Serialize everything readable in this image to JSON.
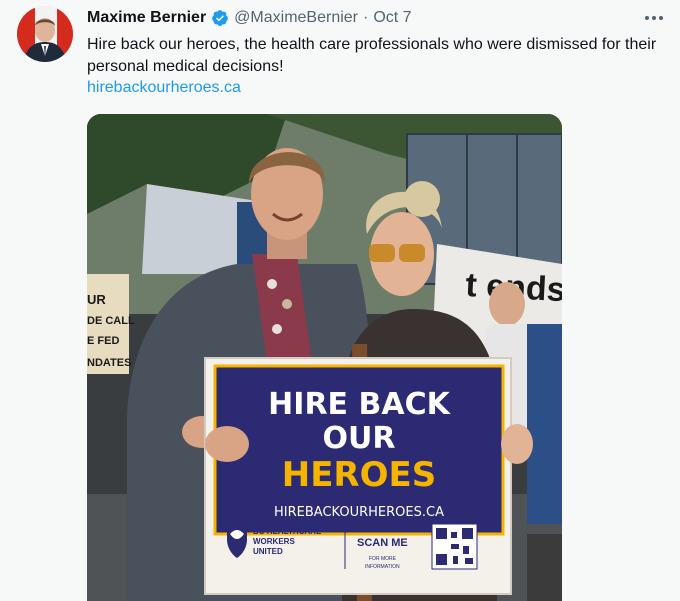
{
  "tweet": {
    "author_name": "Maxime Bernier",
    "handle": "@MaximeBernier",
    "separator": "·",
    "date": "Oct 7",
    "text": "Hire back our heroes, the health care professionals who were dismissed for their personal medical decisions!",
    "link": "hirebackourheroes.ca",
    "verified": true
  },
  "photo": {
    "sign": {
      "line1": "HIRE BACK",
      "line2": "OUR",
      "line3": "HEROES",
      "url": "HIREBACKOURHEROES.CA",
      "org_line1": "BC HEALTHCARE",
      "org_line2": "WORKERS",
      "org_line3": "UNITED",
      "scan": "SCAN ME",
      "scan_sub1": "FOR MORE",
      "scan_sub2": "INFORMATION"
    },
    "banner_text": "t ends",
    "left_sign_lines": [
      "UR",
      "DE CALL",
      "E FED",
      "NDATES"
    ]
  },
  "colors": {
    "accent_link": "#1d9bf0",
    "verified": "#1d9bf0",
    "sign_navy": "#2b2a72",
    "sign_gold": "#f4b400"
  },
  "icons": {
    "verified": "verified-badge-icon",
    "more": "more-horizontal-icon"
  }
}
